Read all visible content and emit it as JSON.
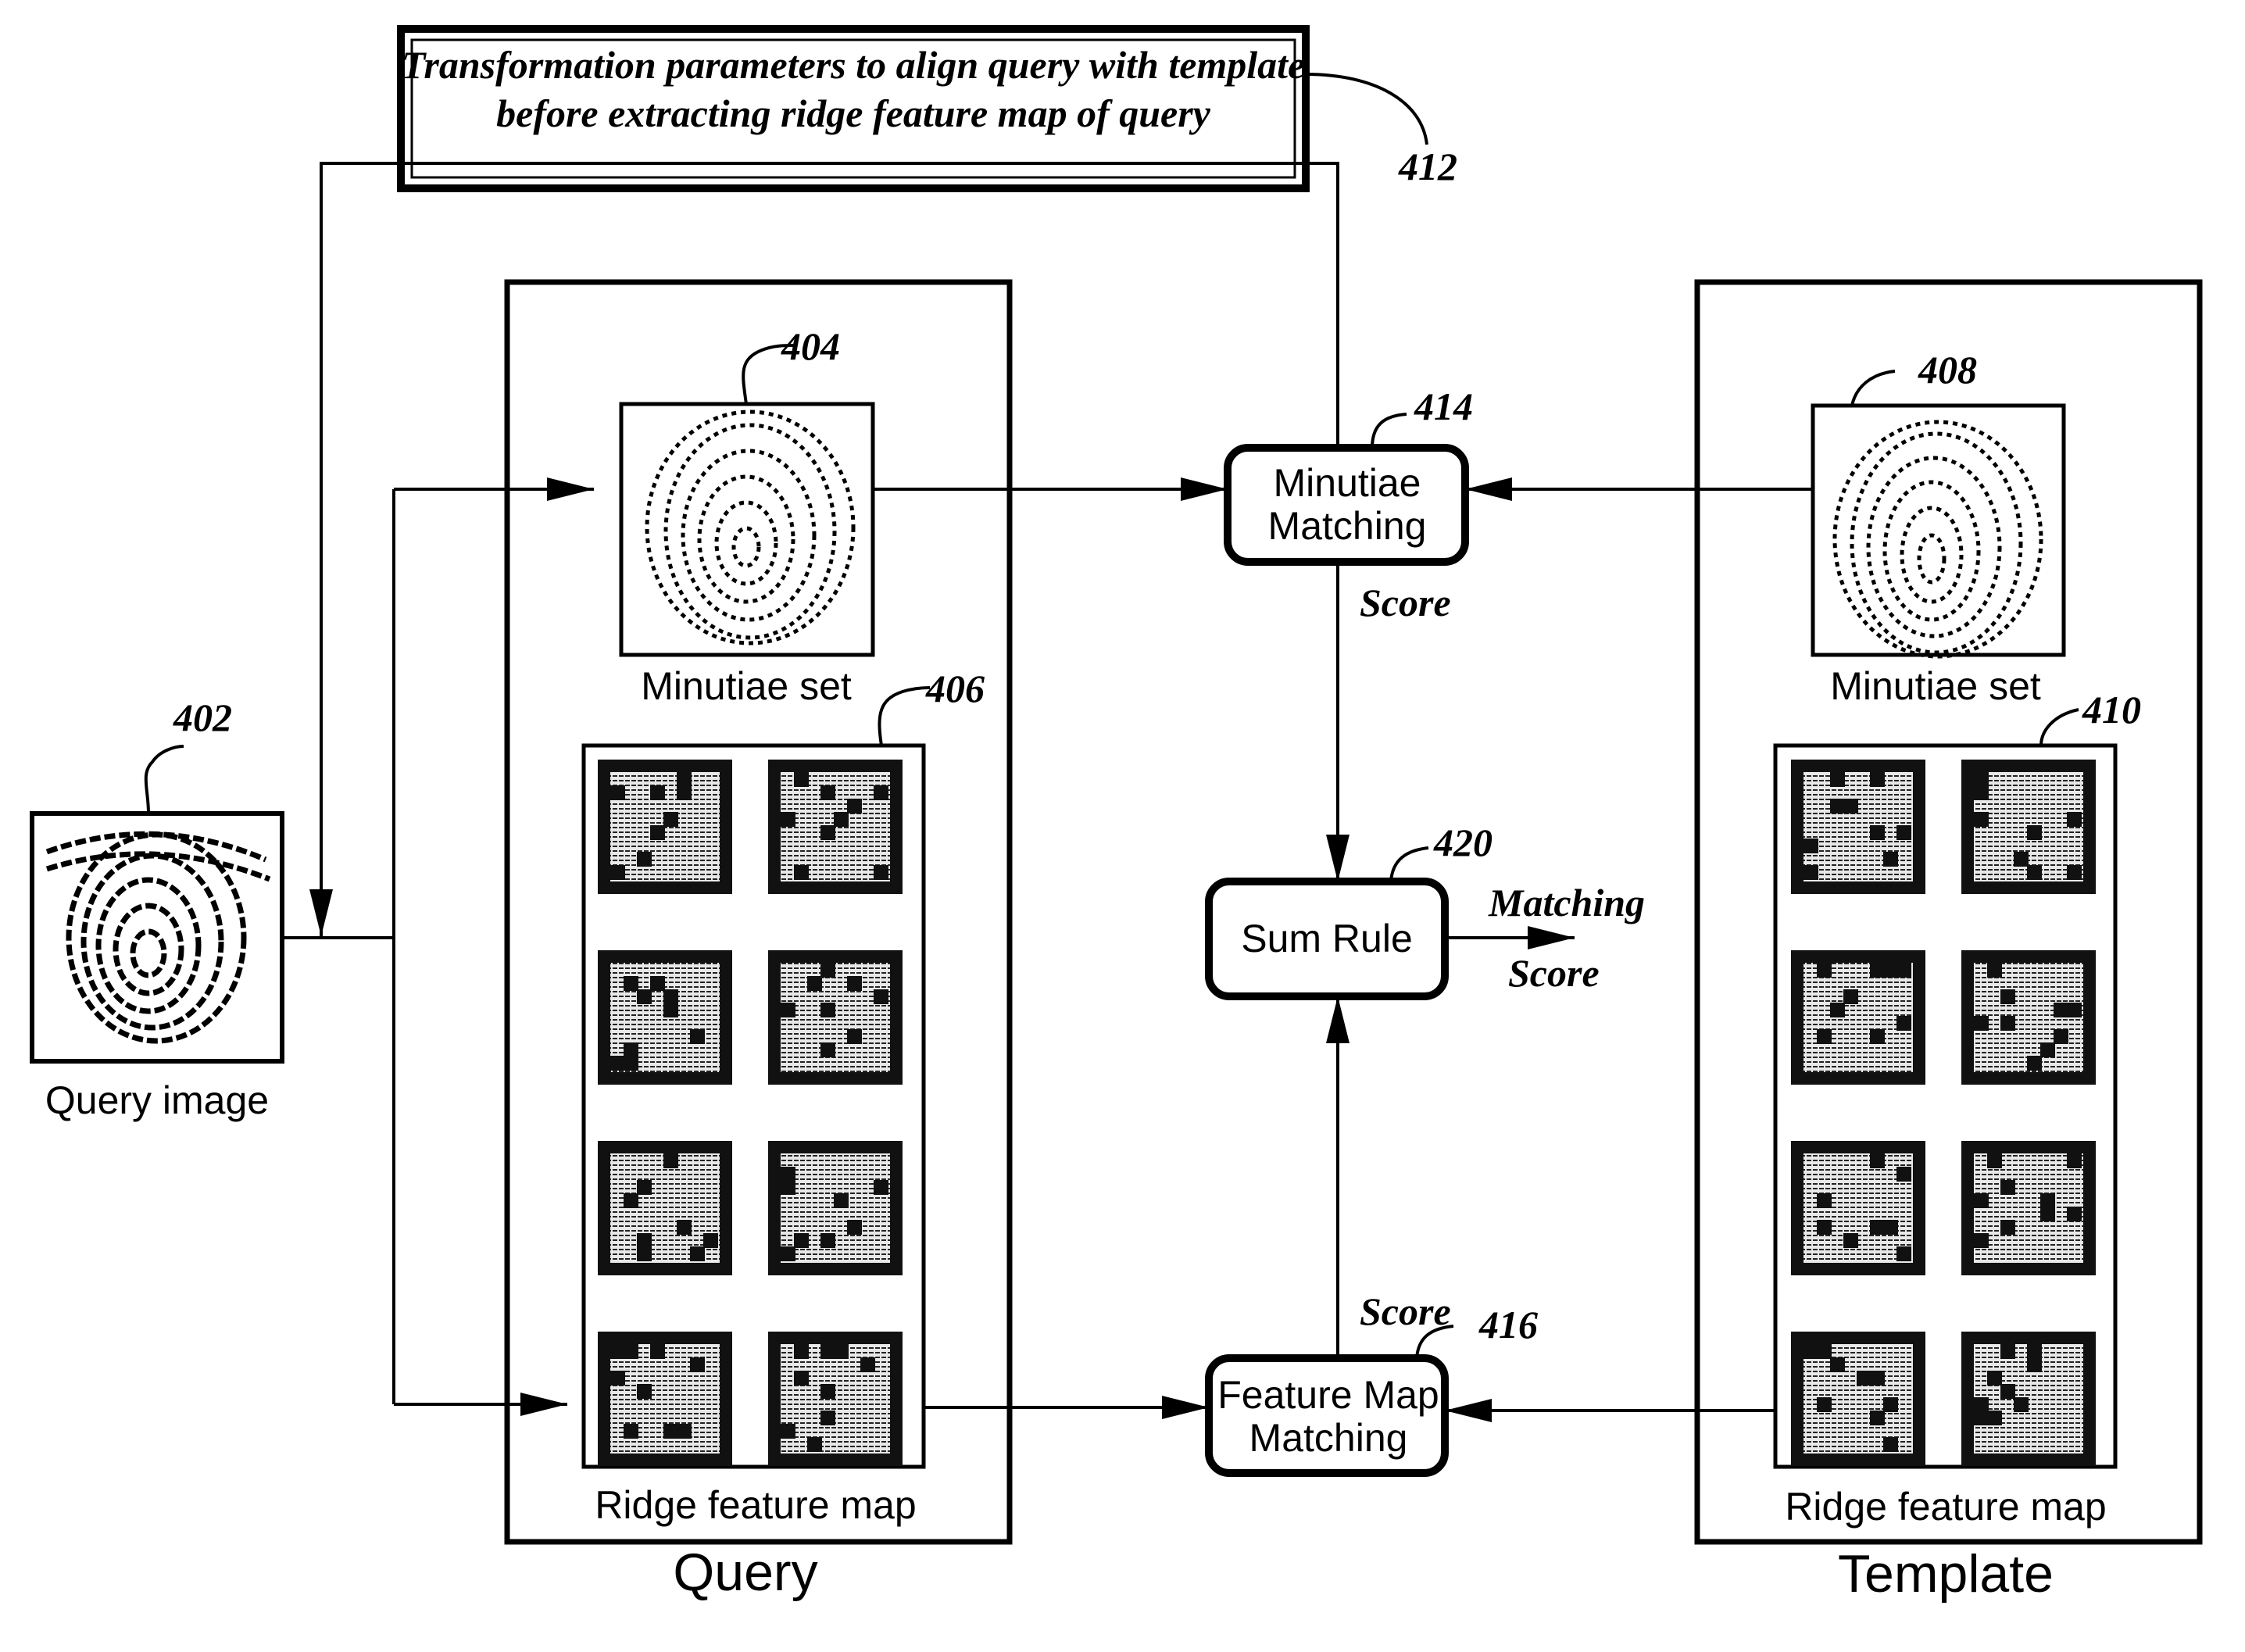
{
  "title_box": {
    "line1": "Transformation parameters to align query with template",
    "line2": "before extracting ridge feature map of query",
    "ref": "412"
  },
  "query_image": {
    "label": "Query image",
    "ref": "402"
  },
  "query_panel": {
    "title": "Query",
    "minutiae": {
      "label": "Minutiae set",
      "ref": "404"
    },
    "ridge": {
      "label": "Ridge feature map",
      "ref": "406"
    }
  },
  "template_panel": {
    "title": "Template",
    "minutiae": {
      "label": "Minutiae set",
      "ref": "408"
    },
    "ridge": {
      "label": "Ridge feature map",
      "ref": "410"
    }
  },
  "minutiae_matching": {
    "line1": "Minutiae",
    "line2": "Matching",
    "ref": "414",
    "output": "Score"
  },
  "feature_map_matching": {
    "line1": "Feature Map",
    "line2": "Matching",
    "ref": "416",
    "output": "Score"
  },
  "sum_rule": {
    "label": "Sum Rule",
    "ref": "420",
    "output_line1": "Matching",
    "output_line2": "Score"
  },
  "ridge_tiles_per_panel": 8
}
